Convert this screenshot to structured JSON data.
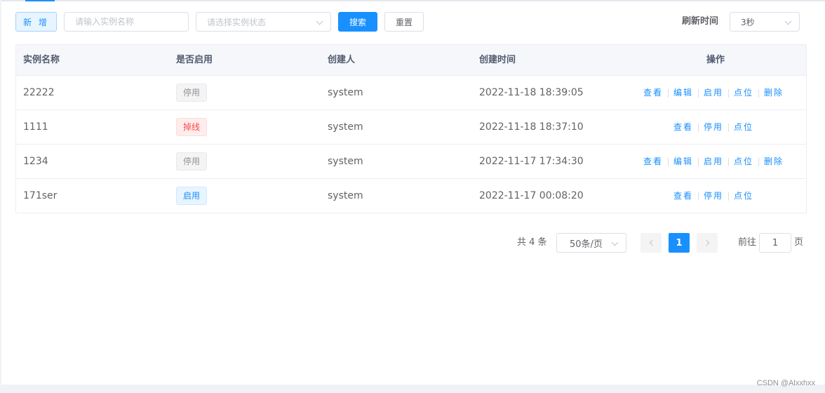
{
  "toolbar": {
    "add_label": "新 增",
    "name_placeholder": "请输入实例名称",
    "status_placeholder": "请选择实例状态",
    "search_label": "搜索",
    "reset_label": "重置",
    "refresh_label": "刷新时间",
    "refresh_value": "3秒"
  },
  "table": {
    "headers": [
      "实例名称",
      "是否启用",
      "创建人",
      "创建时间",
      "操作"
    ],
    "rows": [
      {
        "name": "22222",
        "status": "停用",
        "creator": "system",
        "time": "2022-11-18 18:39:05",
        "ops": [
          "查看",
          "编辑",
          "启用",
          "点位",
          "删除"
        ]
      },
      {
        "name": "1111",
        "status": "掉线",
        "creator": "system",
        "time": "2022-11-18 18:37:10",
        "ops": [
          "查看",
          "停用",
          "点位"
        ]
      },
      {
        "name": "1234",
        "status": "停用",
        "creator": "system",
        "time": "2022-11-17 17:34:30",
        "ops": [
          "查看",
          "编辑",
          "启用",
          "点位",
          "删除"
        ]
      },
      {
        "name": "171ser",
        "status": "启用",
        "creator": "system",
        "time": "2022-11-17 00:08:20",
        "ops": [
          "查看",
          "停用",
          "点位"
        ]
      }
    ]
  },
  "pagination": {
    "total": "共 4 条",
    "page_size": "50条/页",
    "current": "1",
    "goto_label": "前往",
    "goto_value": "1",
    "goto_suffix": "页"
  },
  "colors": {
    "primary": "#1890ff",
    "danger": "#ff4949",
    "muted": "#909399"
  },
  "watermark": "CSDN @Alxxhxx"
}
